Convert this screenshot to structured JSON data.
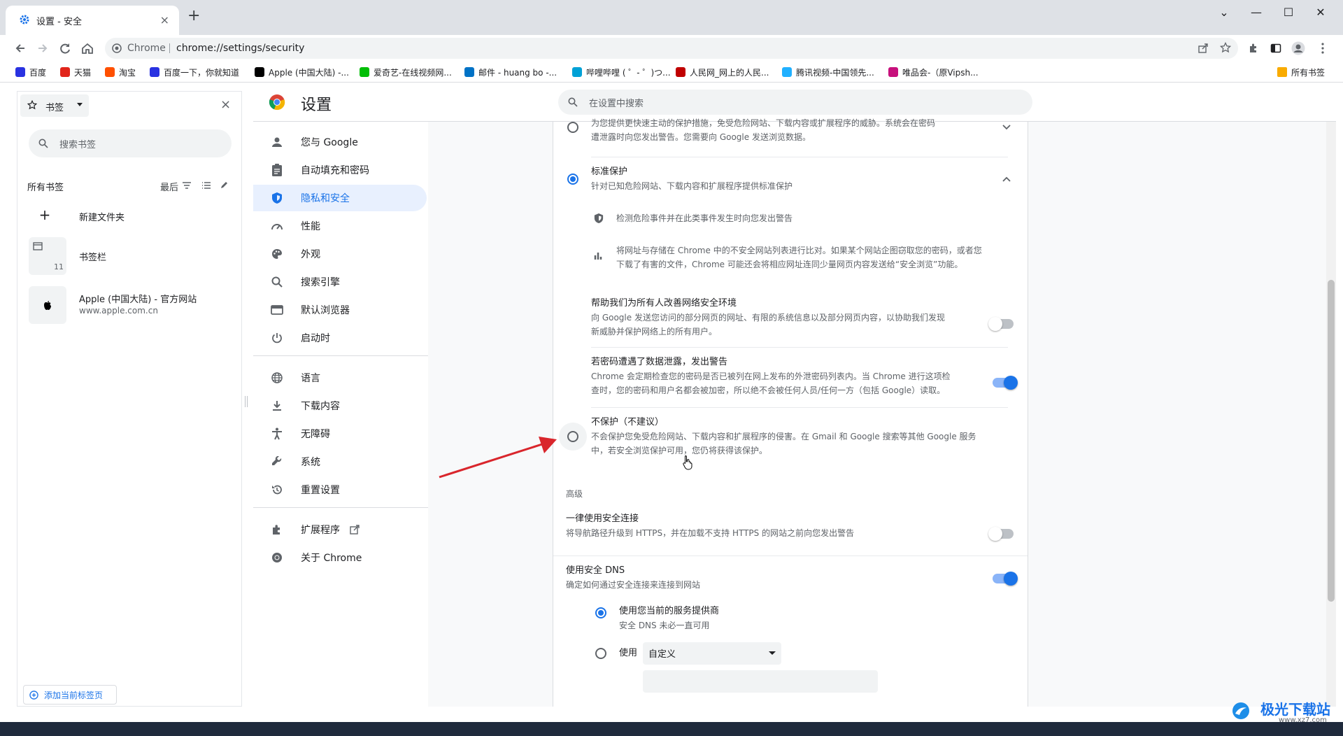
{
  "tab": {
    "title": "设置 - 安全",
    "close": "×"
  },
  "newtab": "+",
  "window_controls": {
    "minimize": "—",
    "maximize": "☐",
    "close": "✕",
    "dropdown": "⌄"
  },
  "omnibox": {
    "site": "Chrome",
    "url": "chrome://settings/security"
  },
  "bookmarks_bar": {
    "items": [
      {
        "label": "百度",
        "color": "#2932e1"
      },
      {
        "label": "天猫",
        "color": "#e1251b"
      },
      {
        "label": "淘宝",
        "color": "#ff5000"
      },
      {
        "label": "百度一下，你就知道",
        "color": "#2932e1"
      },
      {
        "label": "Apple (中国大陆) -...",
        "color": "#000000"
      },
      {
        "label": "爱奇艺-在线视频网...",
        "color": "#00be06"
      },
      {
        "label": "邮件 - huang bo -...",
        "color": "#0072c6"
      },
      {
        "label": "哔哩哔哩 ( ゜- ゜)つ...",
        "color": "#00a1d6"
      },
      {
        "label": "人民网_网上的人民...",
        "color": "#c00000"
      },
      {
        "label": "腾讯视频-中国领先...",
        "color": "#20b0ff"
      },
      {
        "label": "唯品会-（原Vipsh...",
        "color": "#c7107c"
      }
    ],
    "all_bookmarks": "所有书签"
  },
  "side_panel": {
    "header": "书签",
    "close": "×",
    "search_placeholder": "搜索书签",
    "section_title": "所有书签",
    "sort_label": "最后",
    "items": [
      {
        "title": "新建文件夹",
        "sub": ""
      },
      {
        "title": "书签栏",
        "sub": "",
        "count": "11"
      },
      {
        "title": "Apple (中国大陆) - 官方网站",
        "sub": "www.apple.com.cn"
      }
    ],
    "add_current": "添加当前标签页"
  },
  "settings": {
    "title": "设置",
    "search_placeholder": "在设置中搜索",
    "nav": [
      {
        "label": "您与 Google",
        "icon": "person-icon"
      },
      {
        "label": "自动填充和密码",
        "icon": "clipboard-icon"
      },
      {
        "label": "隐私和安全",
        "icon": "shield-icon",
        "active": true
      },
      {
        "label": "性能",
        "icon": "speedometer-icon"
      },
      {
        "label": "外观",
        "icon": "palette-icon"
      },
      {
        "label": "搜索引擎",
        "icon": "search-icon"
      },
      {
        "label": "默认浏览器",
        "icon": "browser-icon"
      },
      {
        "label": "启动时",
        "icon": "power-icon"
      },
      {
        "label": "语言",
        "icon": "globe-icon"
      },
      {
        "label": "下载内容",
        "icon": "download-icon"
      },
      {
        "label": "无障碍",
        "icon": "accessibility-icon"
      },
      {
        "label": "系统",
        "icon": "wrench-icon"
      },
      {
        "label": "重置设置",
        "icon": "history-icon"
      },
      {
        "label": "扩展程序",
        "icon": "puzzle-icon"
      },
      {
        "label": "关于 Chrome",
        "icon": "chrome-icon"
      }
    ]
  },
  "main": {
    "enhanced": {
      "desc1": "为您提供更快速主动的保护措施，免受危险网站、下载内容或扩展程序的威胁。系统会在密码",
      "desc2": "遭泄露时向您发出警告。您需要向 Google 发送浏览数据。"
    },
    "standard": {
      "title": "标准保护",
      "desc": "针对已知危险网站、下载内容和扩展程序提供标准保护",
      "bullet1": "检测危险事件并在此类事件发生时向您发出警告",
      "bullet2_line1": "将网址与存储在 Chrome 中的不安全网站列表进行比对。如果某个网站企图窃取您的密码，或者您",
      "bullet2_line2": "下载了有害的文件，Chrome 可能还会将相应网址连同少量网页内容发送给“安全浏览”功能。",
      "improve_title": "帮助我们为所有人改善网络安全环境",
      "improve_desc1": "向 Google 发送您访问的部分网页的网址、有限的系统信息以及部分网页内容，以协助我们发现",
      "improve_desc2": "新威胁并保护网络上的所有用户。",
      "improve_on": false,
      "leak_title": "若密码遭遇了数据泄露，发出警告",
      "leak_desc1": "Chrome 会定期检查您的密码是否已被列在网上发布的外泄密码列表内。当 Chrome 进行这项检",
      "leak_desc2": "查时，您的密码和用户名都会被加密，所以绝不会被任何人员/任何一方（包括 Google）读取。",
      "leak_on": true
    },
    "no_protection": {
      "title": "不保护（不建议）",
      "desc1": "不会保护您免受危险网站、下载内容和扩展程序的侵害。在 Gmail 和 Google 搜索等其他 Google 服务",
      "desc2": "中，若安全浏览保护可用，您仍将获得该保护。"
    },
    "advanced_label": "高级",
    "https": {
      "title": "一律使用安全连接",
      "desc": "将导航路径升级到 HTTPS，并在加载不支持 HTTPS 的网站之前向您发出警告",
      "on": false
    },
    "dns": {
      "title": "使用安全 DNS",
      "desc": "确定如何通过安全连接来连接到网站",
      "on": true,
      "option1_title": "使用您当前的服务提供商",
      "option1_desc": "安全 DNS 未必一直可用",
      "option2_label": "使用",
      "select_value": "自定义"
    }
  },
  "watermark": {
    "brand": "极光下载站",
    "url": "www.xz7.com"
  },
  "colors": {
    "accent": "#1a73e8",
    "arrow": "#d9262c",
    "nav_active_bg": "#e8f0fe"
  }
}
